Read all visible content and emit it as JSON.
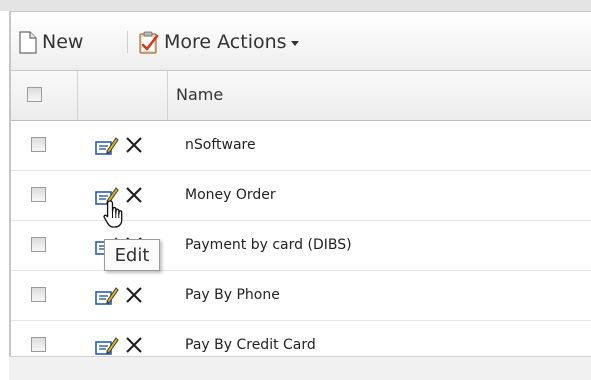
{
  "toolbar": {
    "new_label": "New",
    "more_actions_label": "More Actions"
  },
  "table": {
    "column_name_header": "Name",
    "rows": [
      {
        "name": "nSoftware"
      },
      {
        "name": "Money Order"
      },
      {
        "name": "Payment by card (DIBS)"
      },
      {
        "name": "Pay By Phone"
      },
      {
        "name": "Pay By Credit Card"
      }
    ]
  },
  "tooltip": {
    "text": "Edit"
  },
  "icons": {
    "new": "new-document-icon",
    "more_actions": "clipboard-check-icon",
    "edit": "edit-pencil-icon",
    "delete": "delete-x-icon",
    "cursor": "hand-pointer-cursor-icon"
  },
  "colors": {
    "toolbar_bg": "#f3f3f3",
    "header_bg": "#f0f0f0",
    "border": "#c6c6c6",
    "text": "#333333",
    "edit_icon_blue": "#2a5ea8",
    "pencil_yellow": "#e3b61a"
  }
}
